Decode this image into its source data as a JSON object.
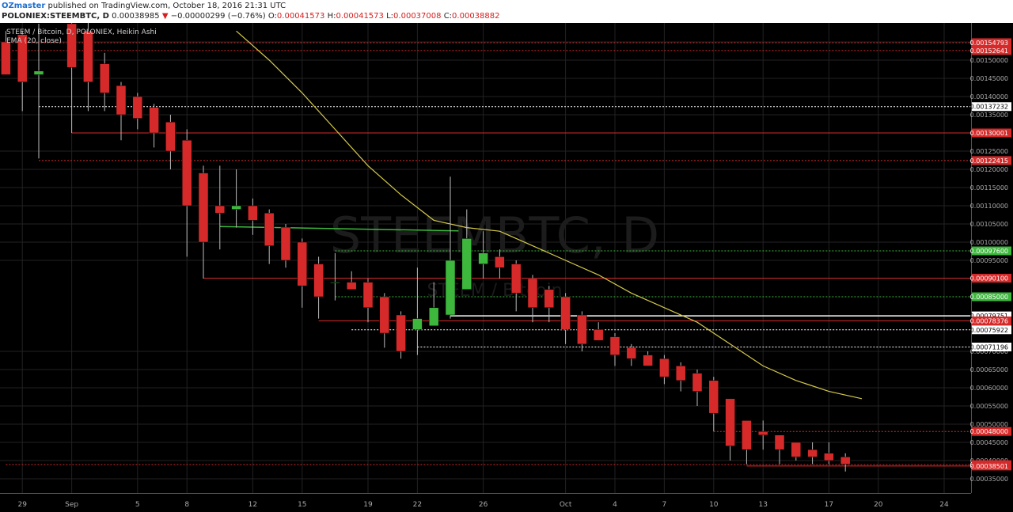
{
  "header": {
    "author": "OZmaster",
    "published": " published on TradingView.com, October 18, 2016 21:31 UTC",
    "symbol": "POLONIEX:STEEMBTC, D",
    "last": "0.00038985",
    "change": "−0.00000299 (−0.76%)",
    "o_label": "O:",
    "o_value": "0.00041573",
    "h_label": "H:",
    "h_value": "0.00041573",
    "l_label": "L:",
    "l_value": "0.00037008",
    "c_label": "C:",
    "c_value": "0.00038882"
  },
  "legend": {
    "line1": "STEEM / Bitcoin, D, POLONIEX, Heikin Ashi",
    "line2": "EMA (20, close)"
  },
  "watermark": {
    "line1": "STEEMBTC, D",
    "line2": "STEEM / Bitcoin"
  },
  "colors": {
    "up": "#3db83d",
    "down": "#d62a2a",
    "ema": "#d4c94a",
    "background": "#000000"
  },
  "chart_data": {
    "type": "candlestick",
    "yscale": {
      "min": 0.00033,
      "max": 0.00157
    },
    "y_ticks": [
      "0.00155000",
      "0.00150000",
      "0.00145000",
      "0.00140000",
      "0.00135000",
      "0.00125000",
      "0.00120000",
      "0.00115000",
      "0.00110000",
      "0.00105000",
      "0.00100000",
      "0.00095000",
      "0.00070000",
      "0.00065000",
      "0.00060000",
      "0.00055000",
      "0.00050000",
      "0.00045000",
      "0.00040000",
      "0.00035000"
    ],
    "x_ticks": [
      {
        "label": "29",
        "i": -1
      },
      {
        "label": "Sep",
        "i": 2
      },
      {
        "label": "5",
        "i": 6
      },
      {
        "label": "8",
        "i": 9
      },
      {
        "label": "12",
        "i": 13
      },
      {
        "label": "15",
        "i": 16
      },
      {
        "label": "19",
        "i": 20
      },
      {
        "label": "22",
        "i": 23
      },
      {
        "label": "26",
        "i": 27
      },
      {
        "label": "Oct",
        "i": 32
      },
      {
        "label": "4",
        "i": 35
      },
      {
        "label": "7",
        "i": 38
      },
      {
        "label": "10",
        "i": 41
      },
      {
        "label": "13",
        "i": 44
      },
      {
        "label": "17",
        "i": 48
      },
      {
        "label": "20",
        "i": 51
      },
      {
        "label": "24",
        "i": 55
      }
    ],
    "candles": [
      {
        "i": -2,
        "o": 0.00155,
        "h": 0.00158,
        "l": 0.00146,
        "c": 0.00146
      },
      {
        "i": -1,
        "o": 0.00157,
        "h": 0.00158,
        "l": 0.00136,
        "c": 0.00144
      },
      {
        "i": 0,
        "o": 0.00146,
        "h": 0.0016,
        "l": 0.00123,
        "c": 0.00147
      },
      {
        "i": 2,
        "o": 0.0016,
        "h": 0.00162,
        "l": 0.0013,
        "c": 0.00148
      },
      {
        "i": 3,
        "o": 0.00158,
        "h": 0.00162,
        "l": 0.00136,
        "c": 0.00144
      },
      {
        "i": 4,
        "o": 0.00149,
        "h": 0.00152,
        "l": 0.00136,
        "c": 0.00141
      },
      {
        "i": 5,
        "o": 0.00143,
        "h": 0.00144,
        "l": 0.00128,
        "c": 0.00135
      },
      {
        "i": 6,
        "o": 0.0014,
        "h": 0.00141,
        "l": 0.00131,
        "c": 0.00134
      },
      {
        "i": 7,
        "o": 0.00137,
        "h": 0.00138,
        "l": 0.00126,
        "c": 0.0013
      },
      {
        "i": 8,
        "o": 0.00133,
        "h": 0.00135,
        "l": 0.0012,
        "c": 0.00125
      },
      {
        "i": 9,
        "o": 0.00128,
        "h": 0.00131,
        "l": 0.00096,
        "c": 0.0011
      },
      {
        "i": 10,
        "o": 0.00119,
        "h": 0.00121,
        "l": 0.0009,
        "c": 0.001
      },
      {
        "i": 11,
        "o": 0.0011,
        "h": 0.00121,
        "l": 0.00098,
        "c": 0.00108
      },
      {
        "i": 12,
        "o": 0.00109,
        "h": 0.0012,
        "l": 0.00104,
        "c": 0.0011
      },
      {
        "i": 13,
        "o": 0.0011,
        "h": 0.00112,
        "l": 0.00102,
        "c": 0.00106
      },
      {
        "i": 14,
        "o": 0.00108,
        "h": 0.00109,
        "l": 0.00094,
        "c": 0.00099
      },
      {
        "i": 15,
        "o": 0.00104,
        "h": 0.00105,
        "l": 0.00093,
        "c": 0.00095
      },
      {
        "i": 16,
        "o": 0.001,
        "h": 0.00101,
        "l": 0.00082,
        "c": 0.00088
      },
      {
        "i": 17,
        "o": 0.00094,
        "h": 0.00096,
        "l": 0.00079,
        "c": 0.00085
      },
      {
        "i": 18,
        "o": 0.00089,
        "h": 0.00097,
        "l": 0.00084,
        "c": 0.00089
      },
      {
        "i": 19,
        "o": 0.00089,
        "h": 0.00092,
        "l": 0.00087,
        "c": 0.00087
      },
      {
        "i": 20,
        "o": 0.00089,
        "h": 0.0009,
        "l": 0.00078,
        "c": 0.00082
      },
      {
        "i": 21,
        "o": 0.00085,
        "h": 0.00086,
        "l": 0.00071,
        "c": 0.00075
      },
      {
        "i": 22,
        "o": 0.0008,
        "h": 0.00081,
        "l": 0.00068,
        "c": 0.0007
      },
      {
        "i": 23,
        "o": 0.00076,
        "h": 0.00093,
        "l": 0.00069,
        "c": 0.00079
      },
      {
        "i": 24,
        "o": 0.00077,
        "h": 0.00089,
        "l": 0.00077,
        "c": 0.00082
      },
      {
        "i": 25,
        "o": 0.0008,
        "h": 0.00118,
        "l": 0.00079,
        "c": 0.00095
      },
      {
        "i": 26,
        "o": 0.00087,
        "h": 0.00109,
        "l": 0.00087,
        "c": 0.00101
      },
      {
        "i": 27,
        "o": 0.00094,
        "h": 0.00103,
        "l": 0.0009,
        "c": 0.00097
      },
      {
        "i": 28,
        "o": 0.00096,
        "h": 0.00098,
        "l": 0.0009,
        "c": 0.00093
      },
      {
        "i": 29,
        "o": 0.00094,
        "h": 0.00095,
        "l": 0.00081,
        "c": 0.00086
      },
      {
        "i": 30,
        "o": 0.0009,
        "h": 0.00091,
        "l": 0.00078,
        "c": 0.00082
      },
      {
        "i": 31,
        "o": 0.00087,
        "h": 0.00088,
        "l": 0.00078,
        "c": 0.00082
      },
      {
        "i": 32,
        "o": 0.00085,
        "h": 0.00086,
        "l": 0.00072,
        "c": 0.00076
      },
      {
        "i": 33,
        "o": 0.0008,
        "h": 0.00081,
        "l": 0.0007,
        "c": 0.00072
      },
      {
        "i": 34,
        "o": 0.00076,
        "h": 0.00078,
        "l": 0.00073,
        "c": 0.00073
      },
      {
        "i": 35,
        "o": 0.00074,
        "h": 0.00075,
        "l": 0.00066,
        "c": 0.00069
      },
      {
        "i": 36,
        "o": 0.00071,
        "h": 0.00072,
        "l": 0.00066,
        "c": 0.00068
      },
      {
        "i": 37,
        "o": 0.00069,
        "h": 0.0007,
        "l": 0.00066,
        "c": 0.00066
      },
      {
        "i": 38,
        "o": 0.00068,
        "h": 0.00069,
        "l": 0.00061,
        "c": 0.00063
      },
      {
        "i": 39,
        "o": 0.00066,
        "h": 0.00067,
        "l": 0.00059,
        "c": 0.00062
      },
      {
        "i": 40,
        "o": 0.00064,
        "h": 0.00065,
        "l": 0.00055,
        "c": 0.00059
      },
      {
        "i": 41,
        "o": 0.00062,
        "h": 0.00063,
        "l": 0.00048,
        "c": 0.00053
      },
      {
        "i": 42,
        "o": 0.00057,
        "h": 0.00057,
        "l": 0.0004,
        "c": 0.00044
      },
      {
        "i": 43,
        "o": 0.00051,
        "h": 0.00051,
        "l": 0.00039,
        "c": 0.00043
      },
      {
        "i": 44,
        "o": 0.00048,
        "h": 0.00051,
        "l": 0.00043,
        "c": 0.00047
      },
      {
        "i": 45,
        "o": 0.00047,
        "h": 0.00047,
        "l": 0.00039,
        "c": 0.00043
      },
      {
        "i": 46,
        "o": 0.00045,
        "h": 0.00045,
        "l": 0.0004,
        "c": 0.00041
      },
      {
        "i": 47,
        "o": 0.00043,
        "h": 0.00045,
        "l": 0.00039,
        "c": 0.00041
      },
      {
        "i": 48,
        "o": 0.00042,
        "h": 0.00045,
        "l": 0.00039,
        "c": 0.0004
      },
      {
        "i": 49,
        "o": 0.00041,
        "h": 0.00042,
        "l": 0.00037,
        "c": 0.00039
      }
    ],
    "ema": [
      {
        "i": 12,
        "v": 0.00158
      },
      {
        "i": 14,
        "v": 0.0015
      },
      {
        "i": 16,
        "v": 0.00141
      },
      {
        "i": 18,
        "v": 0.00131
      },
      {
        "i": 20,
        "v": 0.00121
      },
      {
        "i": 22,
        "v": 0.00113
      },
      {
        "i": 24,
        "v": 0.00106
      },
      {
        "i": 26,
        "v": 0.00104
      },
      {
        "i": 28,
        "v": 0.00103
      },
      {
        "i": 30,
        "v": 0.00099
      },
      {
        "i": 32,
        "v": 0.00095
      },
      {
        "i": 34,
        "v": 0.00091
      },
      {
        "i": 36,
        "v": 0.00086
      },
      {
        "i": 38,
        "v": 0.00082
      },
      {
        "i": 40,
        "v": 0.00078
      },
      {
        "i": 42,
        "v": 0.00072
      },
      {
        "i": 44,
        "v": 0.00066
      },
      {
        "i": 46,
        "v": 0.00062
      },
      {
        "i": 48,
        "v": 0.00059
      },
      {
        "i": 50,
        "v": 0.00057
      }
    ],
    "hlines": [
      {
        "value": 0.00154793,
        "label": "0.00154793",
        "color": "#d62a2a",
        "from_i": -2,
        "dash": true
      },
      {
        "value": 0.00152641,
        "label": "0.00152641",
        "color": "#d62a2a",
        "from_i": -2,
        "dash": true
      },
      {
        "value": 0.00137232,
        "label": "0.00137232",
        "color": "#ffffff",
        "from_i": 0,
        "dash": true
      },
      {
        "value": 0.00130001,
        "label": "0.00130001",
        "color": "#d62a2a",
        "from_i": 2,
        "dash": false
      },
      {
        "value": 0.00122415,
        "label": "0.00122415",
        "color": "#d62a2a",
        "from_i": 0,
        "dash": true
      },
      {
        "value": 0.000976,
        "label": "0.00097600",
        "color": "#3db83d",
        "from_i": 18,
        "dash": true
      },
      {
        "value": 0.000901,
        "label": "0.00090100",
        "color": "#d62a2a",
        "from_i": 10,
        "dash": false
      },
      {
        "value": 0.00085,
        "label": "0.00085000",
        "color": "#3db83d",
        "from_i": 18,
        "dash": true
      },
      {
        "value": 0.00079751,
        "label": "0.00079751",
        "color": "#ffffff",
        "from_i": 25,
        "dash": false
      },
      {
        "value": 0.00078376,
        "label": "0.00078376",
        "color": "#d62a2a",
        "from_i": 17,
        "dash": false
      },
      {
        "value": 0.00075922,
        "label": "0.00075922",
        "color": "#ffffff",
        "from_i": 19,
        "dash": true
      },
      {
        "value": 0.00071196,
        "label": "0.00071196",
        "color": "#ffffff",
        "from_i": 23,
        "dash": true
      },
      {
        "value": 0.00048,
        "label": "0.00048000",
        "color": "#d62a2a",
        "from_i": 41,
        "dash": true
      },
      {
        "value": 0.00038882,
        "label": "0.00038882",
        "color": "#d62a2a",
        "from_i": -2,
        "dash": true
      },
      {
        "value": 0.00038501,
        "label": "0.00038501",
        "color": "#d62a2a",
        "from_i": 43,
        "dash": false
      }
    ],
    "green_trend": {
      "i1": 11,
      "v1": 0.001043,
      "i2": 25.5,
      "v2": 0.001031
    }
  }
}
